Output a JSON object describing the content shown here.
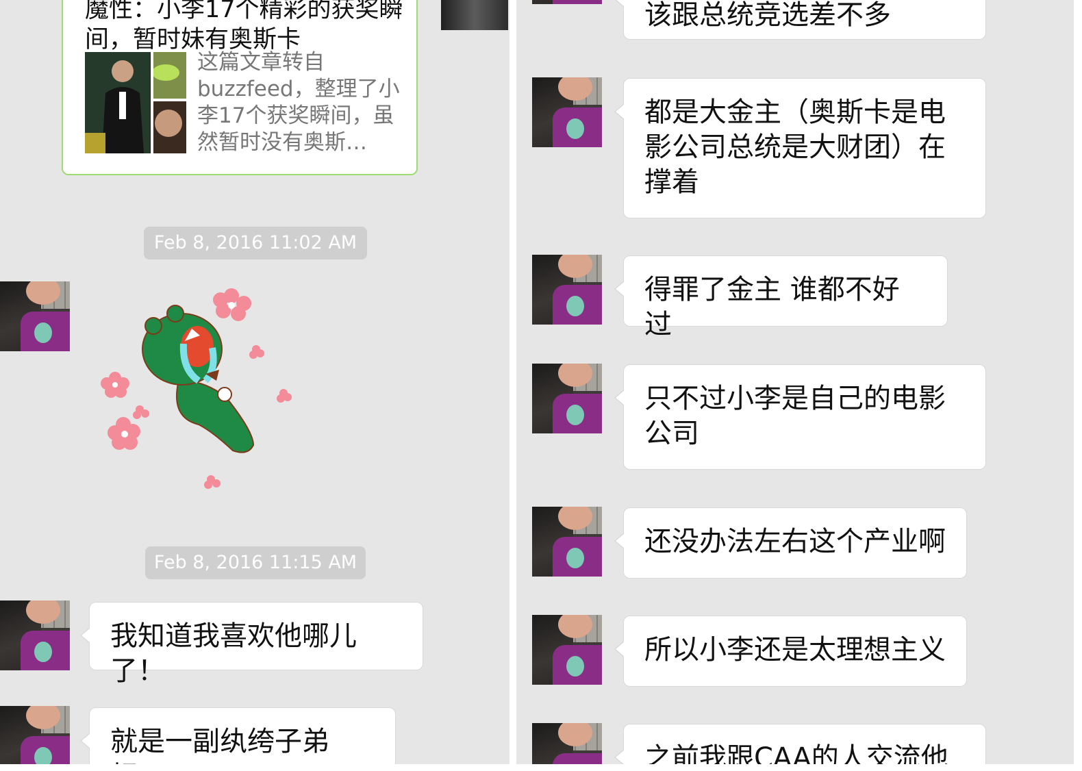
{
  "left": {
    "link_card": {
      "title": "魔性：小李17个精彩的获奖瞬间，暂时妹有奥斯卡",
      "description": "这篇文章转自buzzfeed，整理了小李17个获奖瞬间，虽然暂时没有奥斯…"
    },
    "timestamps": [
      "Feb 8, 2016 11:02 AM",
      "Feb 8, 2016 11:15 AM"
    ],
    "sticker": "green-bear-crying-sticker",
    "messages": [
      "我知道我喜欢他哪儿了！",
      "就是一副纨绔子弟相！"
    ]
  },
  "right": {
    "messages": [
      "该跟总统竞选差不多",
      "都是大金主（奥斯卡是电影公司总统是大财团）在撑着",
      "得罪了金主 谁都不好过",
      "只不过小李是自己的电影公司",
      "还没办法左右这个产业啊",
      "所以小李还是太理想主义",
      "之前我跟CAA的人交流他"
    ]
  },
  "colors": {
    "background": "#e6e6e6",
    "bubble": "#ffffff",
    "card_border": "#9cdc70",
    "timestamp_bg": "#cfcfcf",
    "sticker_green": "#1f8a45",
    "sticker_flowers": "#f38b98"
  }
}
